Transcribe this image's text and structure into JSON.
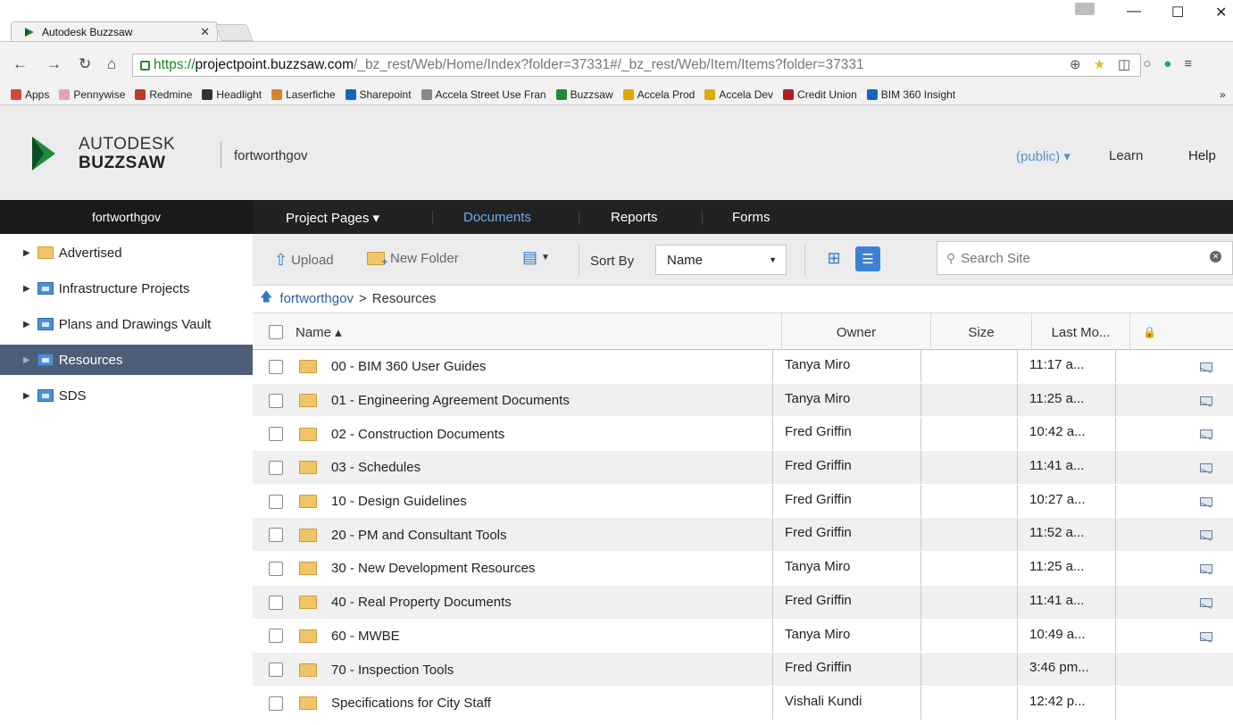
{
  "browser": {
    "tab_title": "Autodesk Buzzsaw",
    "url_scheme": "https://",
    "url_host": "projectpoint.buzzsaw.com",
    "url_path": "/_bz_rest/Web/Home/Index?folder=37331#/_bz_rest/Web/Item/Items?folder=37331",
    "bookmarks": [
      "Apps",
      "Pennywise",
      "Redmine",
      "Headlight",
      "Laserfiche",
      "Sharepoint",
      "Accela Street Use Fran",
      "Buzzsaw",
      "Accela Prod",
      "Accela Dev",
      "Credit Union",
      "BIM 360 Insight"
    ],
    "bookmark_overflow": "»"
  },
  "header": {
    "logo_line1": "AUTODESK",
    "logo_line2": "BUZZSAW",
    "site_name": "fortworthgov",
    "public_menu": "(public) ▾",
    "learn": "Learn",
    "help": "Help"
  },
  "nav": {
    "site": "fortworthgov",
    "items": [
      "Project Pages ▾",
      "Documents",
      "Reports",
      "Forms"
    ],
    "active": "Documents",
    "active_color": "#6ea8f0"
  },
  "sidebar": {
    "items": [
      {
        "label": "Advertised",
        "icon": "folder-icon"
      },
      {
        "label": "Infrastructure Projects",
        "icon": "project-folder-icon"
      },
      {
        "label": "Plans and Drawings Vault",
        "icon": "project-folder-icon"
      },
      {
        "label": "Resources",
        "icon": "project-folder-icon",
        "selected": true
      },
      {
        "label": "SDS",
        "icon": "project-folder-icon"
      }
    ],
    "selected_color": "#4e5e78"
  },
  "toolbar": {
    "upload": "Upload",
    "new_folder": "New Folder",
    "sort_by_label": "Sort By",
    "sort_value": "Name",
    "search_placeholder": "Search Site"
  },
  "breadcrumb": {
    "parent": "fortworthgov",
    "separator": ">",
    "current": "Resources"
  },
  "table": {
    "columns": [
      "Name ▴",
      "Owner",
      "Size",
      "Last Mo...",
      "lock-icon"
    ],
    "rows": [
      {
        "name": "00 - BIM 360 User Guides",
        "owner": "Tanya Miro",
        "size": "",
        "modified": "11:17 a...",
        "mail": true
      },
      {
        "name": "01 - Engineering Agreement Documents",
        "owner": "Tanya Miro",
        "size": "",
        "modified": "11:25 a...",
        "mail": true
      },
      {
        "name": "02 - Construction Documents",
        "owner": "Fred Griffin",
        "size": "",
        "modified": "10:42 a...",
        "mail": true
      },
      {
        "name": "03 - Schedules",
        "owner": "Fred Griffin",
        "size": "",
        "modified": "11:41 a...",
        "mail": true
      },
      {
        "name": "10 - Design Guidelines",
        "owner": "Fred Griffin",
        "size": "",
        "modified": "10:27 a...",
        "mail": true
      },
      {
        "name": "20 - PM and Consultant Tools",
        "owner": "Fred Griffin",
        "size": "",
        "modified": "11:52 a...",
        "mail": true
      },
      {
        "name": "30 - New Development Resources",
        "owner": "Tanya Miro",
        "size": "",
        "modified": "11:25 a...",
        "mail": true
      },
      {
        "name": "40 - Real Property Documents",
        "owner": "Fred Griffin",
        "size": "",
        "modified": "11:41 a...",
        "mail": true
      },
      {
        "name": "60 - MWBE",
        "owner": "Tanya Miro",
        "size": "",
        "modified": "10:49 a...",
        "mail": true
      },
      {
        "name": "70 - Inspection Tools",
        "owner": "Fred Griffin",
        "size": "",
        "modified": "3:46 pm...",
        "mail": false
      },
      {
        "name": "Specifications for City Staff",
        "owner": "Vishali Kundi",
        "size": "",
        "modified": "12:42 p...",
        "mail": false
      }
    ]
  },
  "colors": {
    "accent": "#3b82d6",
    "link": "#2e5da8",
    "brand_green": "#1e8a3a"
  }
}
